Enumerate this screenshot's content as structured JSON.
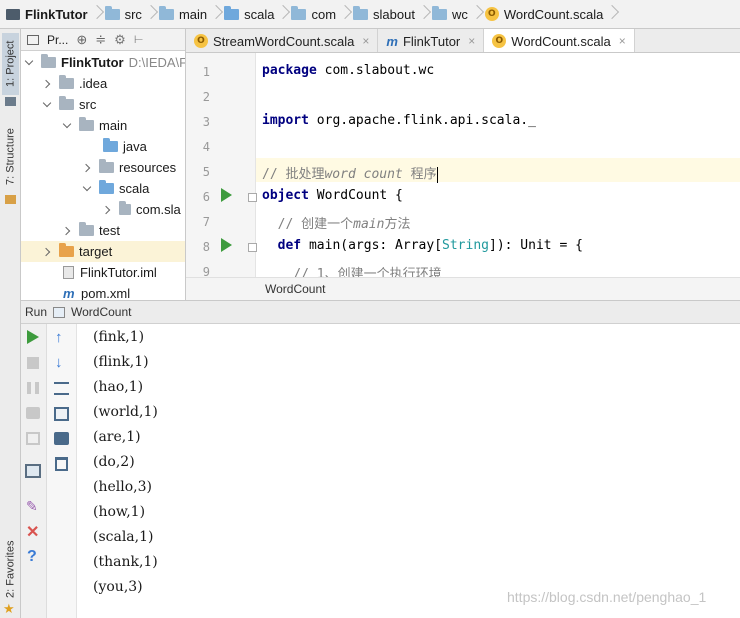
{
  "breadcrumb": [
    {
      "label": "FlinkTutor",
      "icon": "project-icon"
    },
    {
      "label": "src",
      "icon": "folder-icon"
    },
    {
      "label": "main",
      "icon": "folder-icon"
    },
    {
      "label": "scala",
      "icon": "folder-icon"
    },
    {
      "label": "com",
      "icon": "folder-icon"
    },
    {
      "label": "slabout",
      "icon": "folder-icon"
    },
    {
      "label": "wc",
      "icon": "folder-icon"
    },
    {
      "label": "WordCount.scala",
      "icon": "scala-object-icon"
    }
  ],
  "left_stripe": {
    "project_tab": "1: Project",
    "structure_tab": "7: Structure",
    "favorites_tab": "2: Favorites"
  },
  "project_panel": {
    "toolbar_label": "Pr...",
    "tree": [
      {
        "label": "FlinkTutor",
        "suffix": "D:\\IEDA\\F",
        "depth": 0,
        "expanded": true,
        "icon": "project-folder"
      },
      {
        "label": ".idea",
        "depth": 1,
        "expanded": false,
        "icon": "folder"
      },
      {
        "label": "src",
        "depth": 1,
        "expanded": true,
        "icon": "folder"
      },
      {
        "label": "main",
        "depth": 2,
        "expanded": true,
        "icon": "folder"
      },
      {
        "label": "java",
        "depth": 3,
        "icon": "source-folder"
      },
      {
        "label": "resources",
        "depth": 3,
        "expanded": false,
        "icon": "folder"
      },
      {
        "label": "scala",
        "depth": 3,
        "expanded": true,
        "icon": "source-folder"
      },
      {
        "label": "com.sla",
        "depth": 4,
        "expanded": false,
        "icon": "package"
      },
      {
        "label": "test",
        "depth": 2,
        "expanded": false,
        "icon": "folder"
      },
      {
        "label": "target",
        "depth": 1,
        "expanded": false,
        "icon": "excluded-folder",
        "selected": true
      },
      {
        "label": "FlinkTutor.iml",
        "depth": 1,
        "icon": "file"
      },
      {
        "label": "pom.xml",
        "depth": 1,
        "icon": "maven-file"
      }
    ]
  },
  "editor_tabs": [
    {
      "label": "StreamWordCount.scala",
      "active": false,
      "icon": "scala-object-icon"
    },
    {
      "label": "FlinkTutor",
      "active": false,
      "icon": "maven-icon"
    },
    {
      "label": "WordCount.scala",
      "active": true,
      "icon": "scala-object-icon"
    }
  ],
  "editor": {
    "line_numbers": [
      "1",
      "2",
      "3",
      "4",
      "5",
      "6",
      "7",
      "8",
      "9"
    ],
    "lines": {
      "l1_kw": "package",
      "l1_rest": " com.slabout.wc",
      "l3_kw": "import",
      "l3_rest": " org.apache.flink.api.scala._",
      "l5_a": "// 批处理",
      "l5_b": "word count",
      "l5_c": " 程序",
      "l6_kw": "object",
      "l6_rest": " WordCount {",
      "l7_a": "  // 创建一个",
      "l7_b": "main",
      "l7_c": "方法",
      "l8_kw": "  def",
      "l8_a": " main(args: Array[",
      "l8_type": "String",
      "l8_b": "]): Unit = {",
      "l9": "    // 1、创建一个执行环境"
    },
    "footer_crumb": "WordCount"
  },
  "run_panel": {
    "label": "Run",
    "config_name": "WordCount",
    "output": [
      "(fink,1)",
      "(flink,1)",
      "(hao,1)",
      "(world,1)",
      "(are,1)",
      "(do,2)",
      "(hello,3)",
      "(how,1)",
      "(scala,1)",
      "(thank,1)",
      "(you,3)"
    ]
  },
  "watermark": "https://blog.csdn.net/penghao_1",
  "colors": {
    "run_green": "#3d9b3d",
    "selection": "#fbf3d7",
    "current_line": "#fffae3",
    "keyword": "#000080",
    "comment": "#808080"
  }
}
